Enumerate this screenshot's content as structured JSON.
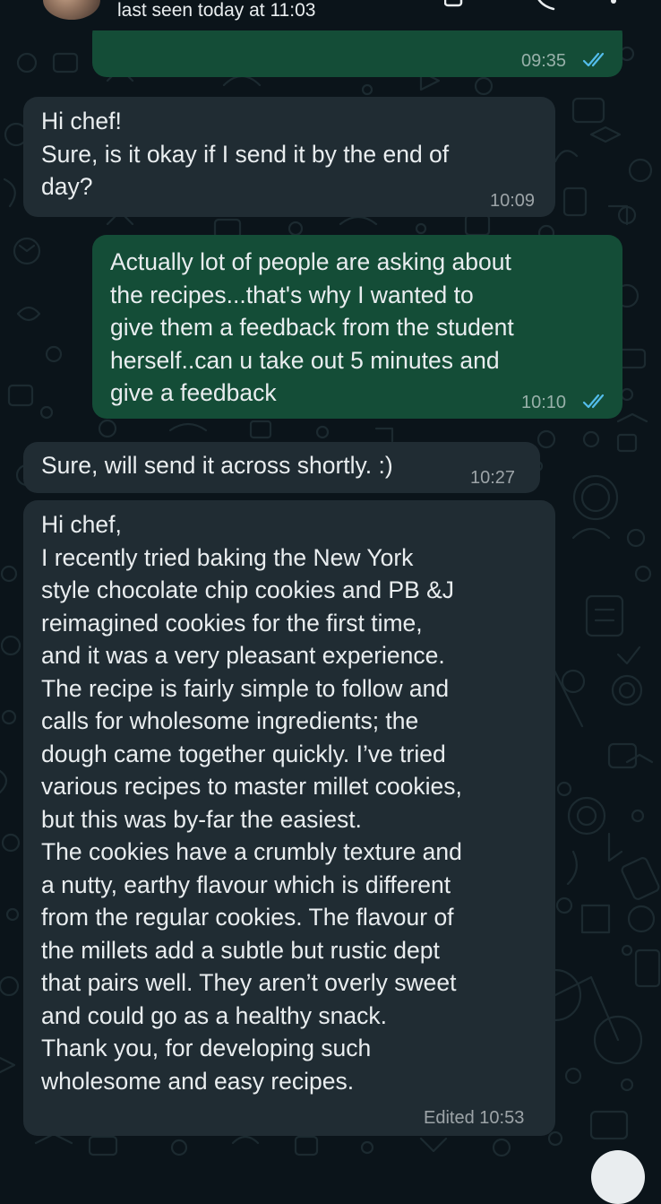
{
  "header": {
    "status": "last seen today at 11:03",
    "icons": [
      "avatar",
      "video-call-icon",
      "voice-call-icon",
      "more-options-icon"
    ]
  },
  "theme": {
    "background": "#0b141a",
    "outgoing_bubble": "#144d37",
    "incoming_bubble": "#202c33",
    "read_tick_color": "#53bdeb"
  },
  "messages": [
    {
      "direction": "outgoing",
      "text": "",
      "time": "09:35",
      "status": "read"
    },
    {
      "direction": "incoming",
      "text": "Hi chef!\nSure, is it okay if I send it by the end of\nday?",
      "time": "10:09"
    },
    {
      "direction": "outgoing",
      "text": "Actually lot of people are asking about\nthe recipes...that's why I wanted to\ngive them a feedback from the student\nherself..can u take out 5 minutes and\ngive a feedback",
      "time": "10:10",
      "status": "read"
    },
    {
      "direction": "incoming",
      "text": "Sure, will send it across shortly. :)",
      "time": "10:27"
    },
    {
      "direction": "incoming",
      "text": "Hi chef,\nI recently tried baking the New York\nstyle chocolate chip cookies and PB &J\nreimagined cookies for the first time,\nand it was a very pleasant experience.\nThe recipe is fairly simple to follow and\ncalls for wholesome ingredients; the\ndough came together quickly. I’ve tried\nvarious recipes to master millet cookies,\nbut this was by-far the easiest.\nThe cookies have a crumbly texture and\na nutty, earthy flavour which is different\nfrom the regular cookies. The flavour of\nthe millets add a subtle but rustic dept\nthat pairs well. They aren’t overly sweet\nand could go as a healthy snack.\nThank you, for developing such\nwholesome and easy recipes.",
      "time": "Edited 10:53"
    }
  ]
}
